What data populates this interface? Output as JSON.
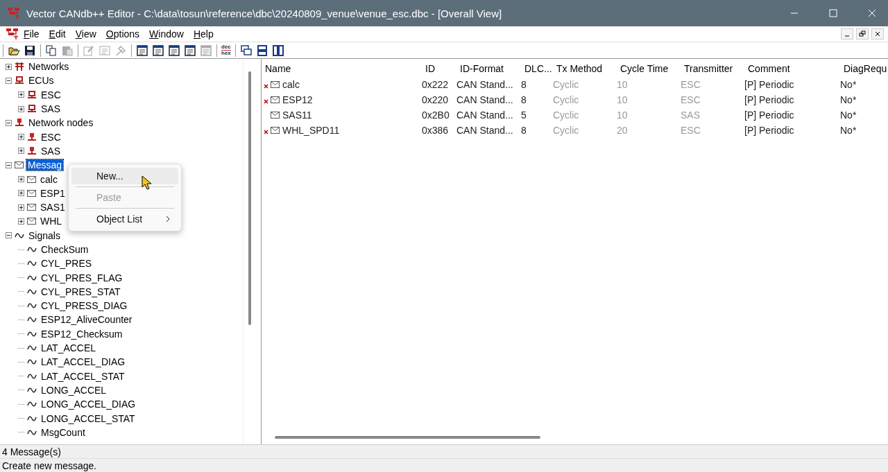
{
  "window": {
    "title": "Vector CANdb++ Editor - C:\\data\\tosun\\reference\\dbc\\20240809_venue\\venue_esc.dbc - [Overall View]"
  },
  "menu": [
    {
      "label": "File"
    },
    {
      "label": "Edit"
    },
    {
      "label": "View"
    },
    {
      "label": "Options"
    },
    {
      "label": "Window"
    },
    {
      "label": "Help"
    }
  ],
  "toolbar": [
    {
      "buttons": [
        {
          "kind": "open",
          "disabled": false
        },
        {
          "kind": "save",
          "disabled": false
        }
      ]
    },
    {
      "buttons": [
        {
          "kind": "copy",
          "disabled": false
        },
        {
          "kind": "paste",
          "disabled": true
        }
      ]
    },
    {
      "buttons": [
        {
          "kind": "edit",
          "disabled": true
        },
        {
          "kind": "form",
          "disabled": true
        },
        {
          "kind": "tool",
          "disabled": true
        }
      ]
    },
    {
      "buttons": [
        {
          "kind": "view",
          "disabled": false
        },
        {
          "kind": "view",
          "disabled": false
        },
        {
          "kind": "view",
          "disabled": false
        },
        {
          "kind": "view",
          "disabled": false
        },
        {
          "kind": "view",
          "disabled": true
        }
      ]
    },
    {
      "buttons": [
        {
          "kind": "dechex",
          "label_top": "dec",
          "label_bottom": "hex",
          "disabled": false
        }
      ]
    },
    {
      "buttons": [
        {
          "kind": "cascade",
          "disabled": false
        },
        {
          "kind": "tile-h",
          "disabled": false
        },
        {
          "kind": "tile-v",
          "disabled": false
        }
      ]
    }
  ],
  "tree": [
    {
      "label": "Networks",
      "kind": "network",
      "expanded": false,
      "selected": false
    },
    {
      "label": "ECUs",
      "kind": "ecu",
      "expanded": true,
      "selected": false,
      "children": [
        {
          "label": "ESC",
          "kind": "ecu",
          "expanded": false,
          "selected": false
        },
        {
          "label": "SAS",
          "kind": "ecu",
          "expanded": false,
          "selected": false
        }
      ]
    },
    {
      "label": "Network nodes",
      "kind": "node",
      "expanded": true,
      "selected": false,
      "children": [
        {
          "label": "ESC",
          "kind": "node",
          "expanded": false,
          "selected": false
        },
        {
          "label": "SAS",
          "kind": "node",
          "expanded": false,
          "selected": false
        }
      ]
    },
    {
      "label": "Messag",
      "kind": "message",
      "expanded": true,
      "selected": true,
      "children": [
        {
          "label": "calc",
          "kind": "message",
          "expanded": false,
          "selected": false
        },
        {
          "label": "ESP1",
          "kind": "message",
          "expanded": false,
          "selected": false
        },
        {
          "label": "SAS1",
          "kind": "message",
          "expanded": false,
          "selected": false
        },
        {
          "label": "WHL",
          "kind": "message",
          "expanded": false,
          "selected": false
        }
      ]
    },
    {
      "label": "Signals",
      "kind": "signal",
      "expanded": true,
      "selected": false,
      "children": [
        {
          "label": "CheckSum",
          "kind": "signal"
        },
        {
          "label": "CYL_PRES",
          "kind": "signal"
        },
        {
          "label": "CYL_PRES_FLAG",
          "kind": "signal"
        },
        {
          "label": "CYL_PRES_STAT",
          "kind": "signal"
        },
        {
          "label": "CYL_PRESS_DIAG",
          "kind": "signal"
        },
        {
          "label": "ESP12_AliveCounter",
          "kind": "signal"
        },
        {
          "label": "ESP12_Checksum",
          "kind": "signal"
        },
        {
          "label": "LAT_ACCEL",
          "kind": "signal"
        },
        {
          "label": "LAT_ACCEL_DIAG",
          "kind": "signal"
        },
        {
          "label": "LAT_ACCEL_STAT",
          "kind": "signal"
        },
        {
          "label": "LONG_ACCEL",
          "kind": "signal"
        },
        {
          "label": "LONG_ACCEL_DIAG",
          "kind": "signal"
        },
        {
          "label": "LONG_ACCEL_STAT",
          "kind": "signal"
        },
        {
          "label": "MsgCount",
          "kind": "signal"
        }
      ]
    }
  ],
  "table": {
    "columns": [
      {
        "label": "Name",
        "inherited": false
      },
      {
        "label": "ID",
        "inherited": false
      },
      {
        "label": "ID-Format",
        "inherited": false
      },
      {
        "label": "DLC...",
        "inherited": false
      },
      {
        "label": "Tx Method",
        "inherited": true
      },
      {
        "label": "Cycle Time",
        "inherited": true
      },
      {
        "label": "Transmitter",
        "inherited": true
      },
      {
        "label": "Comment",
        "inherited": false
      },
      {
        "label": "DiagRequ",
        "inherited": false
      }
    ],
    "rows": [
      {
        "error": true,
        "cells": [
          "calc",
          "0x222",
          "CAN Stand...",
          "8",
          "Cyclic",
          "10",
          "ESC",
          "[P] Periodic",
          "No*"
        ]
      },
      {
        "error": true,
        "cells": [
          "ESP12",
          "0x220",
          "CAN Stand...",
          "8",
          "Cyclic",
          "10",
          "ESC",
          "[P] Periodic",
          "No*"
        ]
      },
      {
        "error": false,
        "cells": [
          "SAS11",
          "0x2B0",
          "CAN Stand...",
          "5",
          "Cyclic",
          "10",
          "SAS",
          "[P] Periodic",
          "No*"
        ]
      },
      {
        "error": true,
        "cells": [
          "WHL_SPD11",
          "0x386",
          "CAN Stand...",
          "8",
          "Cyclic",
          "20",
          "ESC",
          "[P] Periodic",
          "No*"
        ]
      }
    ]
  },
  "context_menu": {
    "items": [
      {
        "label": "New...",
        "hovered": true,
        "disabled": false,
        "submenu": false
      },
      {
        "label": "Paste",
        "hovered": false,
        "disabled": true,
        "submenu": false
      },
      {
        "label": "Object List",
        "hovered": false,
        "disabled": false,
        "submenu": true
      }
    ]
  },
  "status_bar": {
    "count": "4 Message(s)",
    "hint": "Create new message."
  }
}
